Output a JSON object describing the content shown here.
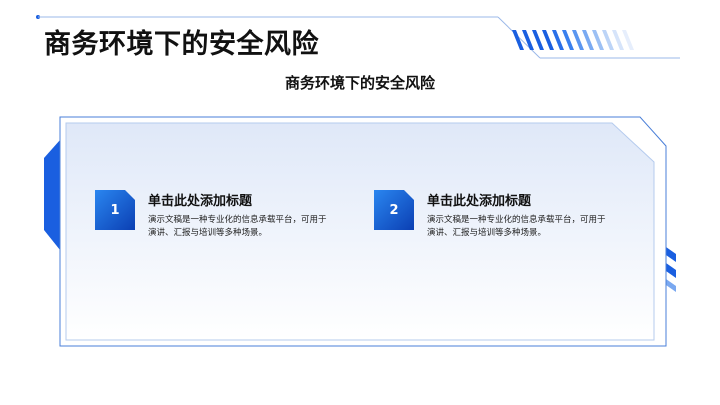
{
  "slide": {
    "title": "商务环境下的安全风险",
    "subtitle": "商务环境下的安全风险"
  },
  "items": [
    {
      "number": "1",
      "heading": "单击此处添加标题",
      "description": "演示文稿是一种专业化的信息承载平台，可用于演讲、汇报与培训等多种场景。"
    },
    {
      "number": "2",
      "heading": "单击此处添加标题",
      "description": "演示文稿是一种专业化的信息承载平台，可用于演讲、汇报与培训等多种场景。"
    }
  ],
  "colors": {
    "accent": "#1a5fe0",
    "accent_light": "#7aa8f0",
    "panel_border": "#4a7fd8"
  }
}
